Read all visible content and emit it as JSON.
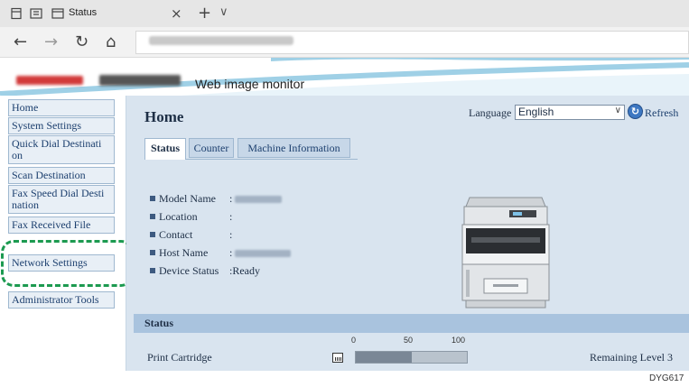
{
  "browser": {
    "tab_title": "Status",
    "close_glyph": "×",
    "new_tab_glyph": "+",
    "more_glyph": "∨",
    "back_glyph": "←",
    "forward_glyph": "→",
    "refresh_glyph": "↻",
    "home_glyph": "⌂"
  },
  "header": {
    "app_title": "Web image monitor"
  },
  "sidebar": {
    "items": [
      {
        "label": "Home"
      },
      {
        "label": "System Settings"
      },
      {
        "label": "Quick Dial Destinati on"
      },
      {
        "label": "Scan Destination"
      },
      {
        "label": "Fax Speed Dial Desti nation"
      },
      {
        "label": "Fax Received File"
      },
      {
        "label": "Network Settings"
      },
      {
        "label": "Administrator Tools"
      }
    ],
    "highlight_color": "#1c9a50"
  },
  "main": {
    "title": "Home",
    "language_label": "Language",
    "language_value": "English",
    "refresh_label": "Refresh",
    "tabs": [
      {
        "label": "Status",
        "active": true
      },
      {
        "label": "Counter",
        "active": false
      },
      {
        "label": "Machine Information",
        "active": false
      }
    ],
    "info": [
      {
        "label": "Model Name",
        "sep": ":",
        "value": ""
      },
      {
        "label": "Location",
        "sep": ":",
        "value": ""
      },
      {
        "label": "Contact",
        "sep": ":",
        "value": ""
      },
      {
        "label": "Host Name",
        "sep": ":",
        "value": ""
      },
      {
        "label": "Device Status",
        "sep": ":",
        "value": "Ready"
      }
    ],
    "status_section": {
      "title": "Status",
      "scale": [
        "0",
        "50",
        "100"
      ],
      "print_cartridge_label": "Print Cartridge",
      "print_cartridge_level": 0.5,
      "remaining_text": "Remaining Level 3"
    }
  },
  "caption": "DYG617",
  "colors": {
    "content_bg": "#d9e4ef",
    "section_header": "#a9c3de",
    "link_text": "#1c3f6e"
  }
}
